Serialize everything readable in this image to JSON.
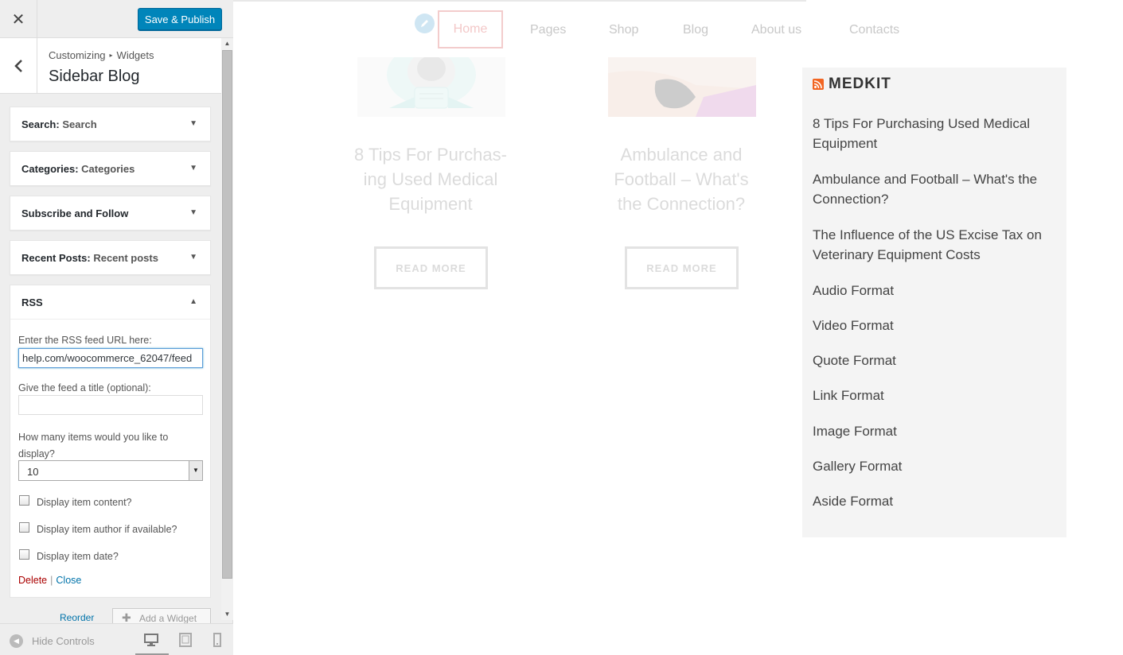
{
  "topbar": {
    "close_glyph": "✕",
    "publish_label": "Save & Publish"
  },
  "panel": {
    "crumb_root": "Customizing",
    "crumb_sep": "▸",
    "crumb_child": "Widgets",
    "title": "Sidebar Blog"
  },
  "widgets": [
    {
      "name": "Search",
      "sub": "Search"
    },
    {
      "name": "Categories",
      "sub": "Categories"
    },
    {
      "name": "Subscribe and Follow",
      "sub": ""
    },
    {
      "name": "Recent Posts",
      "sub": "Recent posts"
    }
  ],
  "rss_form": {
    "title": "RSS",
    "url_label": "Enter the RSS feed URL here:",
    "url_value": "help.com/woocommerce_62047/feed",
    "title_label": "Give the feed a title (optional):",
    "title_value": "",
    "count_label": "How many items would you like to display?",
    "count_value": "10",
    "options": [
      {
        "label": "Display item content?",
        "checked": false
      },
      {
        "label": "Display item author if available?",
        "checked": false
      },
      {
        "label": "Display item date?",
        "checked": false
      }
    ],
    "delete_label": "Delete",
    "sep": "|",
    "close_label": "Close"
  },
  "sidebar_footer": {
    "reorder_label": "Reorder",
    "add_widget_label": "Add a Widget",
    "hide_controls_label": "Hide Controls",
    "active_device": "desktop"
  },
  "site_nav": {
    "items": [
      "Home",
      "Pages",
      "Shop",
      "Blog",
      "About us",
      "Contacts"
    ],
    "active": "Home"
  },
  "posts": [
    {
      "title": "8 Tips For Purchas- ing Used Medical Equipment",
      "button": "READ MORE"
    },
    {
      "title": "Ambulance and Football – What's the Connection?",
      "button": "READ MORE"
    }
  ],
  "rss_widget": {
    "title": "MEDKIT",
    "items": [
      "8 Tips For Purchasing Used Medical Equipment",
      "Ambulance and Football – What's the Connection?",
      "The Influence of the US Excise Tax on Veterinary Equipment Costs",
      "Audio Format",
      "Video Format",
      "Quote Format",
      "Link Format",
      "Image Format",
      "Gallery Format",
      "Aside Format"
    ]
  },
  "colors": {
    "primary_button": "#0085ba",
    "delete_link": "#aa0000",
    "link": "#0073aa",
    "rss_orange": "#f26522",
    "active_nav_border": "#f3cccc"
  },
  "icons": [
    "close-icon",
    "back-arrow-icon",
    "chevron-down-icon",
    "chevron-up-icon",
    "pencil-icon",
    "rss-feed-icon",
    "plus-icon",
    "desktop-icon",
    "tablet-icon",
    "mobile-icon",
    "collapse-icon"
  ]
}
